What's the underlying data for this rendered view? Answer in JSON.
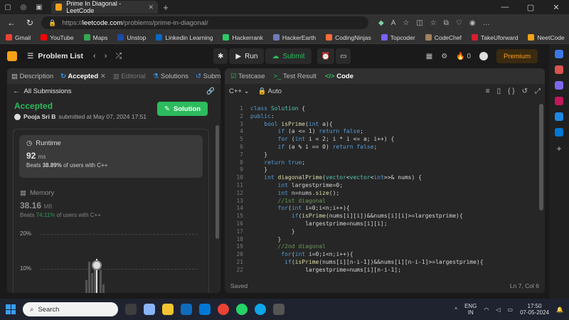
{
  "browser": {
    "tab_title": "Prime In Diagonal - LeetCode",
    "url_prefix": "https://",
    "url_domain": "leetcode.com",
    "url_path": "/problems/prime-in-diagonal/",
    "bookmarks": [
      {
        "label": "Gmail",
        "color": "#ea4335"
      },
      {
        "label": "YouTube",
        "color": "#ff0000"
      },
      {
        "label": "Maps",
        "color": "#34a853"
      },
      {
        "label": "Unstop",
        "color": "#1c4aa8"
      },
      {
        "label": "Linkedin Learning",
        "color": "#0a66c2"
      },
      {
        "label": "Hackerrank",
        "color": "#2ec866"
      },
      {
        "label": "HackerEarth",
        "color": "#323754"
      },
      {
        "label": "CodingNinjas",
        "color": "#f66c3b"
      },
      {
        "label": "Topcoder",
        "color": "#7b61ff"
      },
      {
        "label": "CodeChef",
        "color": "#5b4638"
      },
      {
        "label": "TakeUforward",
        "color": "#d41f30"
      },
      {
        "label": "NeetCode",
        "color": "#f4a118"
      }
    ]
  },
  "nav": {
    "problem_list": "Problem List",
    "run": "Run",
    "submit": "Submit",
    "streak": "0",
    "premium": "Premium"
  },
  "left": {
    "tabs": [
      "Description",
      "Accepted",
      "Editorial",
      "Solutions",
      "Submi"
    ],
    "all_submissions": "All Submissions",
    "status": "Accepted",
    "submitter": "Pooja Sri B",
    "submitted_text": "submitted at May 07, 2024 17:51",
    "solution_button": "Solution",
    "runtime_title": "Runtime",
    "runtime_value": "92",
    "runtime_unit": "ms",
    "runtime_beats_prefix": "Beats",
    "runtime_beats": "38.89%",
    "runtime_beats_suffix": "of users with C++",
    "memory_title": "Memory",
    "memory_value": "38.16",
    "memory_unit": "MB",
    "memory_beats_prefix": "Beats",
    "memory_beats": "74.11%",
    "memory_beats_suffix": "of users with C++",
    "chart_ticks": [
      "20%",
      "10%"
    ]
  },
  "right": {
    "tabs": [
      "Testcase",
      "Test Result",
      "Code"
    ],
    "language": "C++",
    "mode": "Auto",
    "status": "Saved",
    "cursor": "Ln 7, Col 6",
    "code_lines": [
      "class Solution {",
      "public:",
      "    bool isPrime(int a){",
      "        if (a <= 1) return false;",
      "        for (int i = 2; i * i <= a; i++) {",
      "        if (a % i == 0) return false;",
      "    }",
      "    return true;",
      "    }",
      "    int diagonalPrime(vector<vector<int>>& nums) {",
      "        int largestprime=0;",
      "        int n=nums.size();",
      "        //1st diagonal",
      "        for(int i=0;i<n;i++){",
      "            if(isPrime(nums[i][i])&&nums[i][i]>=largestprime){",
      "                largestprime=nums[i][i];",
      "            }",
      "        }",
      "        //2nd diagonal",
      "         for(int i=0;i<n;i++){",
      "          if(isPrime(nums[i][n-i-1])&&nums[i][n-i-1]>=largestprime){",
      "                largestprime=nums[i][n-i-1];"
    ]
  },
  "taskbar": {
    "search": "Search",
    "lang1": "ENG",
    "lang2": "IN",
    "time": "17:50",
    "date": "07-05-2024"
  }
}
